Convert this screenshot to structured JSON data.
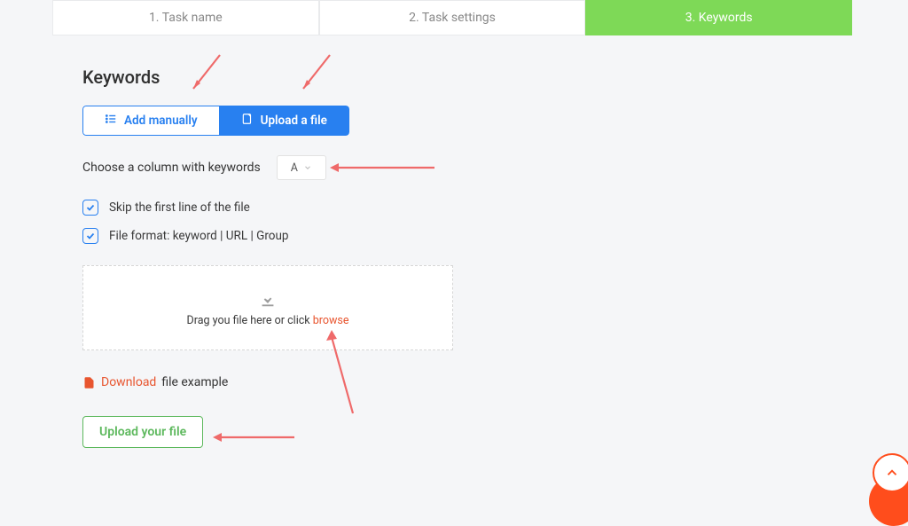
{
  "wizard": {
    "tab1": "1. Task name",
    "tab2": "2. Task settings",
    "tab3": "3. Keywords"
  },
  "section_title": "Keywords",
  "toggle": {
    "manual_label": "Add manually",
    "upload_label": "Upload a file"
  },
  "column_row": {
    "label": "Choose a column with keywords",
    "selected": "A"
  },
  "checks": {
    "skip_first": "Skip the first line of the file",
    "file_format": "File format: keyword | URL | Group"
  },
  "dropzone": {
    "prefix": "Drag you file here or click ",
    "browse": "browse"
  },
  "download": {
    "link": "Download",
    "rest": " file example"
  },
  "upload_button": "Upload your file"
}
